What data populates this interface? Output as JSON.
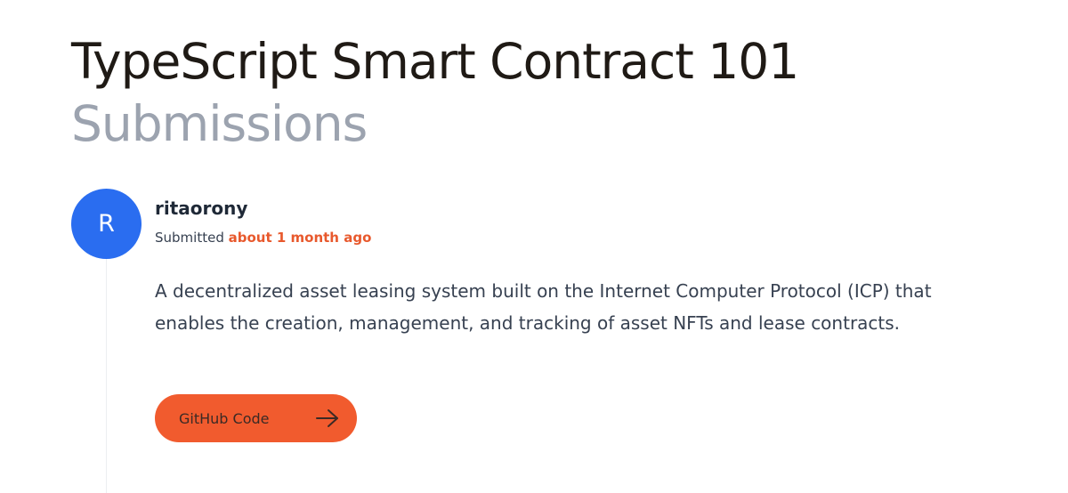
{
  "header": {
    "title": "TypeScript Smart Contract 101",
    "subtitle": "Submissions"
  },
  "submission": {
    "avatar_initial": "R",
    "username": "ritaorony",
    "submitted_prefix": "Submitted",
    "submitted_time": "about 1 month ago",
    "description": "A decentralized asset leasing system built on the Internet Computer Protocol (ICP) that enables the creation, management, and tracking of asset NFTs and lease contracts.",
    "button_label": "GitHub Code",
    "button_icon": "arrow-right-icon"
  },
  "colors": {
    "avatar": "#2a6df0",
    "accent": "#f15b2e",
    "time_text": "#e8592d",
    "title": "#1f1a15",
    "subtitle": "#9ca3af"
  }
}
